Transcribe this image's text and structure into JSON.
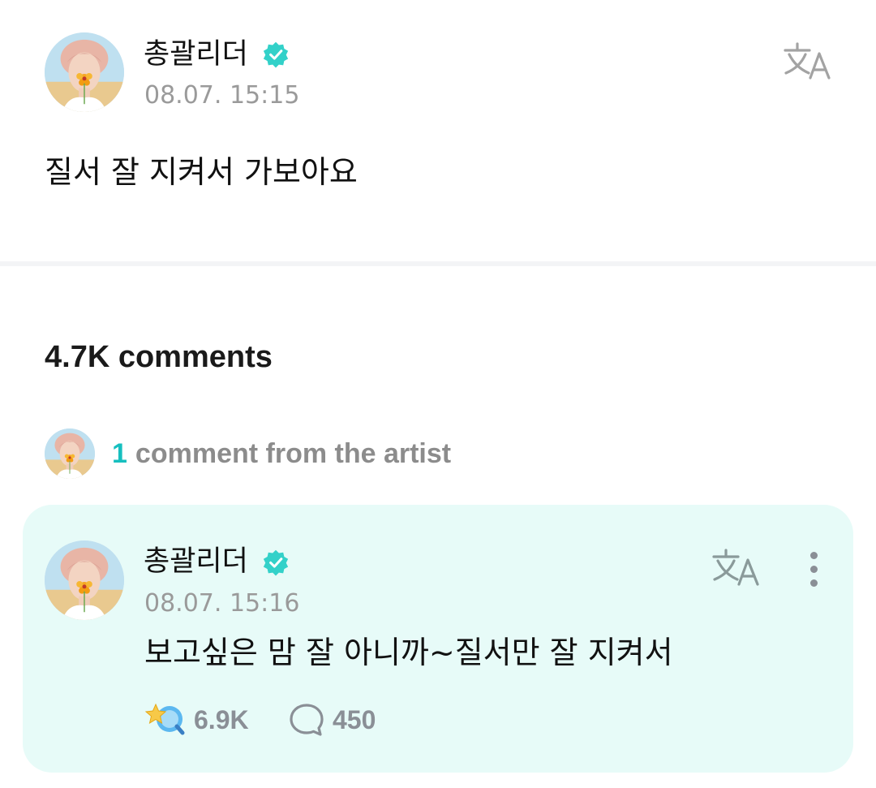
{
  "post": {
    "author": "총괄리더",
    "verified": true,
    "timestamp": "08.07. 15:15",
    "body": "질서 잘 지켜서 가보아요",
    "translate_icon": "translate-icon"
  },
  "comments_section": {
    "count_label": "4.7K comments",
    "artist_comment_count": "1",
    "artist_comment_label": "comment from the artist"
  },
  "artist_comment": {
    "author": "총괄리더",
    "verified": true,
    "timestamp": "08.07. 15:16",
    "body": "보고싶은 맘 잘 아니까~질서만 잘 지켜서",
    "likes": "6.9K",
    "replies": "450",
    "translate_icon": "translate-icon",
    "more_icon": "more-vertical-icon"
  },
  "colors": {
    "accent": "#16bfbf",
    "verified_badge": "#33d1c9",
    "card_background": "#e7fbf8",
    "muted_text": "#9a9a9a"
  }
}
